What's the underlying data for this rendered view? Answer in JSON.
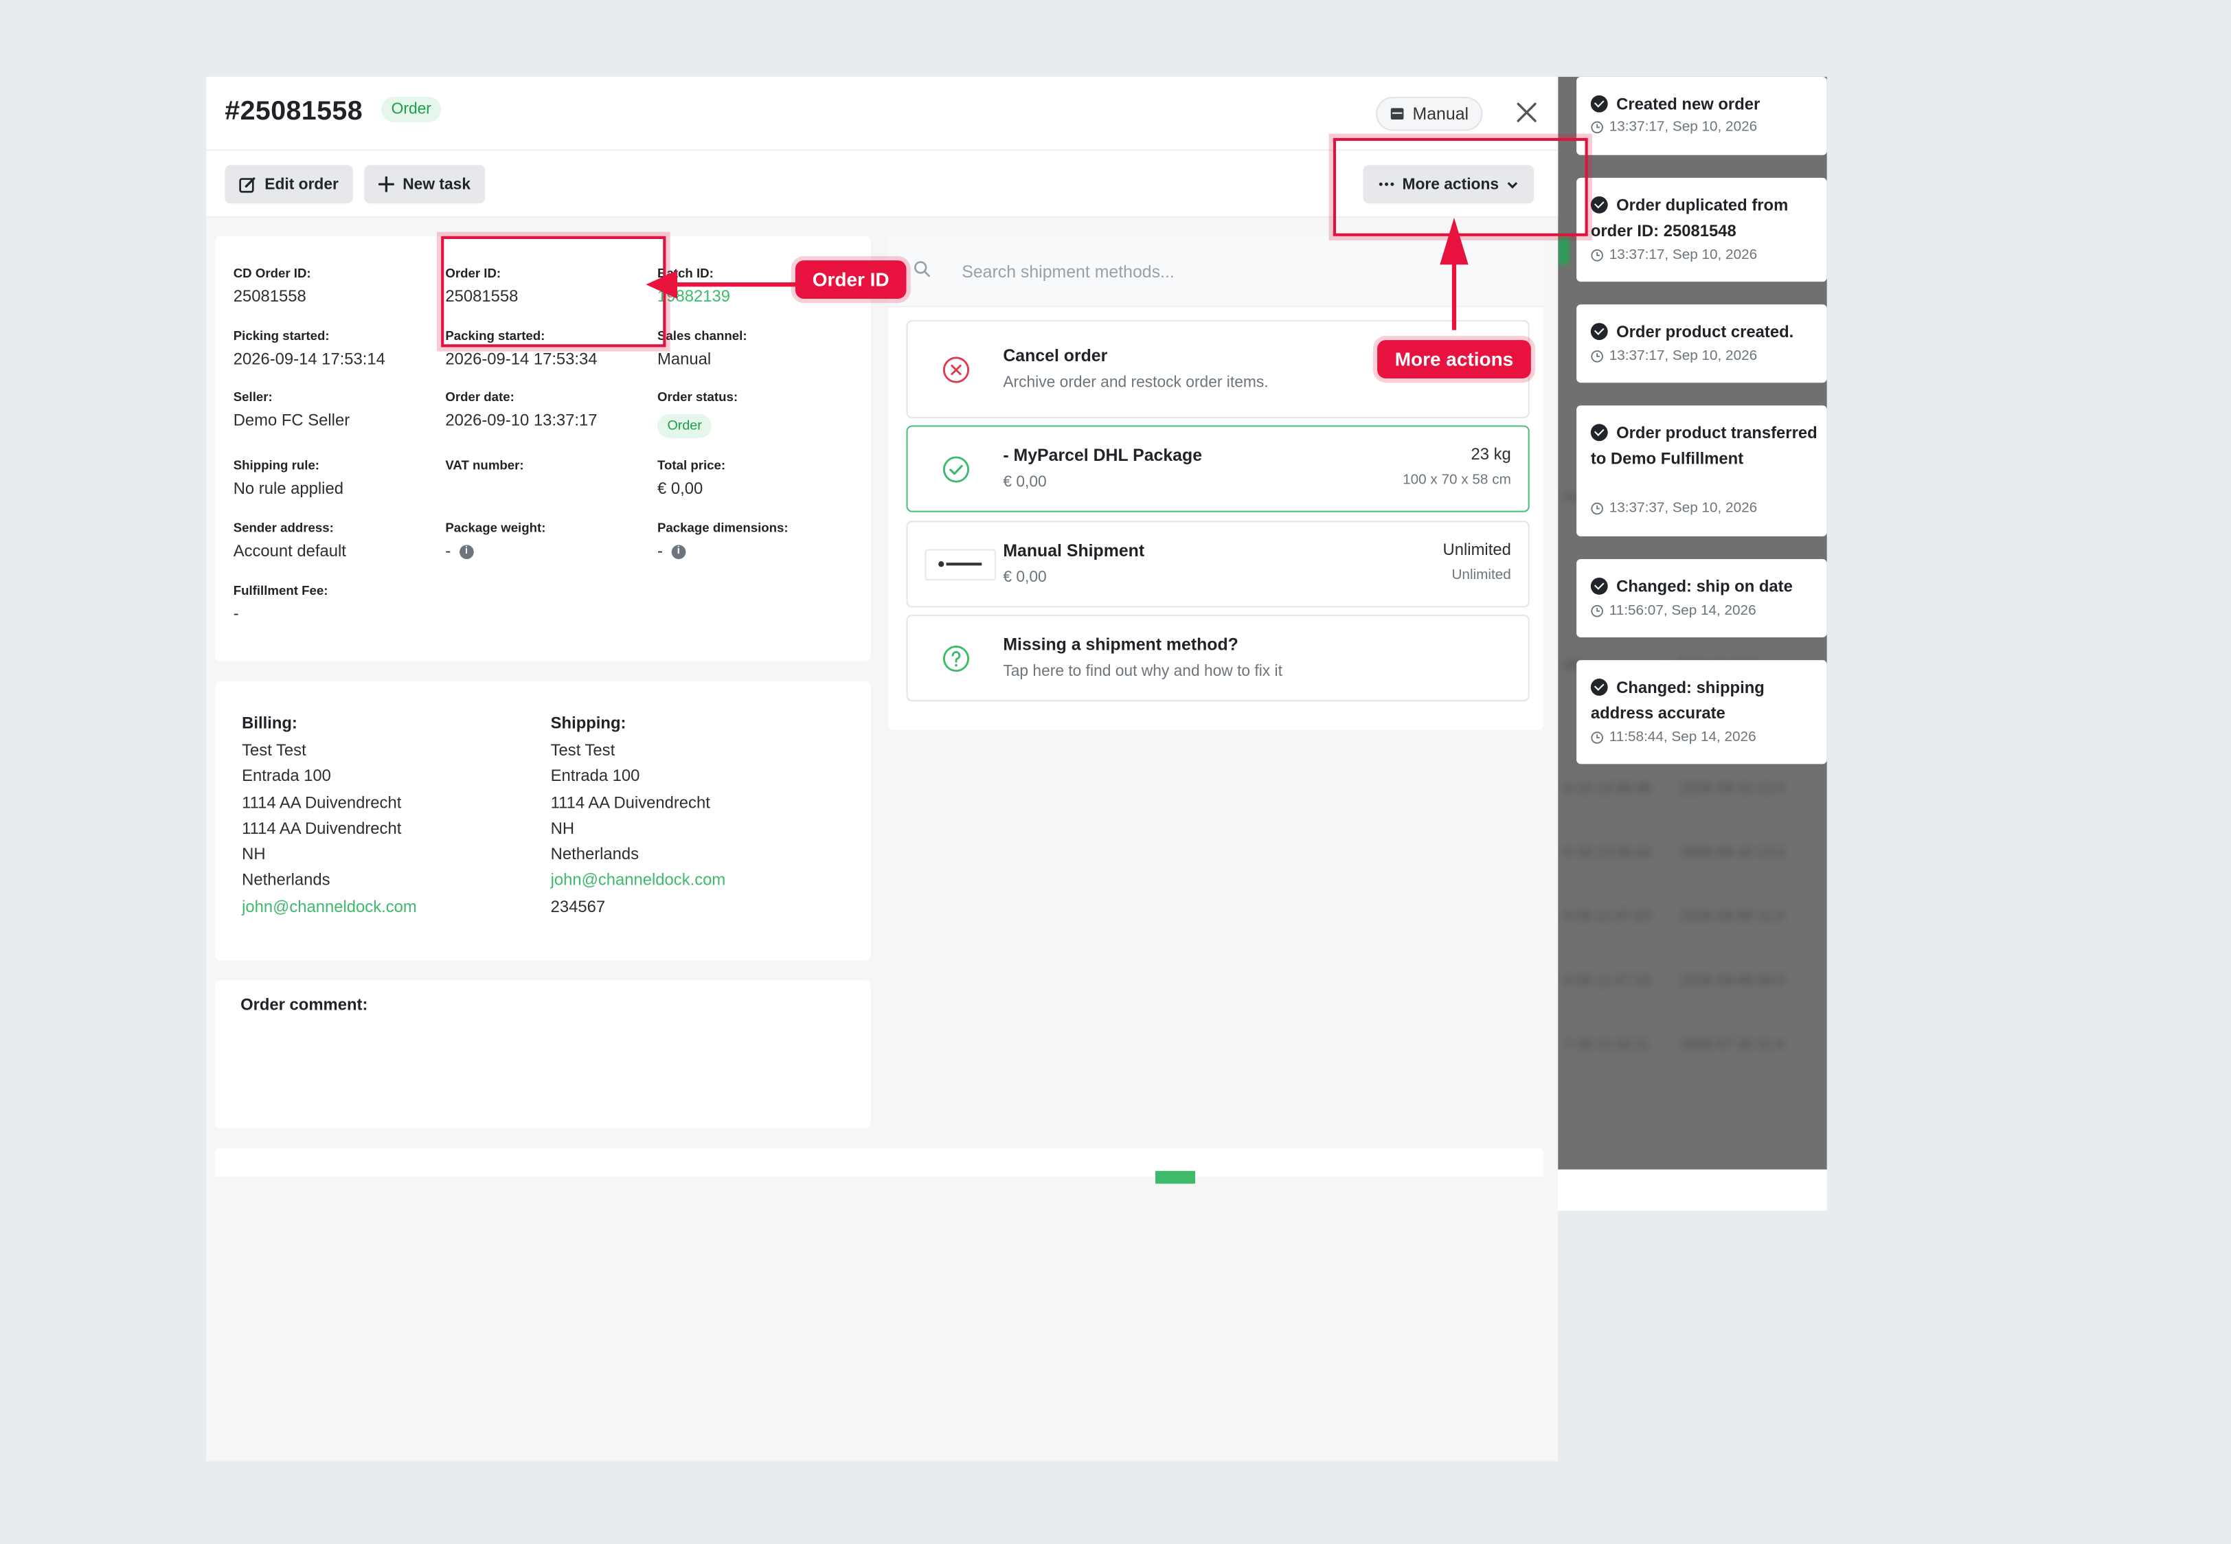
{
  "order": {
    "title": "#25081558",
    "status_badge": "Order",
    "channel_chip": "Manual"
  },
  "toolbar": {
    "edit_label": "Edit order",
    "new_task_label": "New task",
    "more_actions_label": "More actions"
  },
  "info": {
    "cd_order_id": {
      "label": "CD Order ID:",
      "value": "25081558"
    },
    "order_id": {
      "label": "Order ID:",
      "value": "25081558"
    },
    "batch_id": {
      "label": "Batch ID:",
      "value": "19882139"
    },
    "picking_started": {
      "label": "Picking started:",
      "value": "2026-09-14 17:53:14"
    },
    "packing_started": {
      "label": "Packing started:",
      "value": "2026-09-14 17:53:34"
    },
    "sales_channel": {
      "label": "Sales channel:",
      "value": "Manual"
    },
    "seller": {
      "label": "Seller:",
      "value": "Demo FC Seller"
    },
    "order_date": {
      "label": "Order date:",
      "value": "2026-09-10 13:37:17"
    },
    "order_status": {
      "label": "Order status:",
      "value": "Order"
    },
    "shipping_rule": {
      "label": "Shipping rule:",
      "value": "No rule applied"
    },
    "vat_number": {
      "label": "VAT number:",
      "value": ""
    },
    "total_price": {
      "label": "Total price:",
      "value": "€ 0,00"
    },
    "sender_address": {
      "label": "Sender address:",
      "value": "Account default"
    },
    "package_weight": {
      "label": "Package weight:",
      "value": "-"
    },
    "package_dimensions": {
      "label": "Package dimensions:",
      "value": "-"
    },
    "fulfillment_fee": {
      "label": "Fulfillment Fee:",
      "value": "-"
    }
  },
  "billing": {
    "title": "Billing:",
    "lines": [
      "Test Test",
      "Entrada 100",
      "1114 AA Duivendrecht",
      "1114 AA Duivendrecht",
      "NH",
      "Netherlands"
    ],
    "email": "john@channeldock.com"
  },
  "shipping_address": {
    "title": "Shipping:",
    "lines": [
      "Test Test",
      "Entrada 100",
      "1114 AA Duivendrecht",
      "NH",
      "Netherlands"
    ],
    "email": "john@channeldock.com",
    "phone": "234567"
  },
  "comment": {
    "label": "Order comment:"
  },
  "shipment": {
    "search_placeholder": "Search shipment methods...",
    "methods": [
      {
        "title": "Cancel order",
        "subtitle": "Archive order and restock order items.",
        "icon": "x-circle-icon"
      },
      {
        "title": "- MyParcel DHL Package",
        "subtitle": "€ 0,00",
        "weight": "23 kg",
        "dimensions": "100 x 70 x 58 cm",
        "icon": "check-circle-icon",
        "selected": true
      },
      {
        "title": "Manual Shipment",
        "subtitle": "€ 0,00",
        "right_top": "Unlimited",
        "right_bottom": "Unlimited",
        "icon": "channeldock-logo"
      },
      {
        "title": "Missing a shipment method?",
        "subtitle": "Tap here to find out why and how to fix it",
        "icon": "question-circle-icon"
      }
    ]
  },
  "timeline": [
    {
      "title": "Created new order",
      "time": "13:37:17, Sep 10, 2026"
    },
    {
      "title": "Order duplicated from order ID: 25081548",
      "time": "13:37:17, Sep 10, 2026"
    },
    {
      "title": "Order product created.",
      "time": "13:37:17, Sep 10, 2026"
    },
    {
      "title": "Order product transferred to Demo Fulfillment",
      "time": "13:37:37, Sep 10, 2026"
    },
    {
      "title": "Changed: ship on date",
      "time": "11:56:07, Sep 14, 2026"
    },
    {
      "title": "Changed: shipping address accurate",
      "time": "11:58:44, Sep 14, 2026"
    }
  ],
  "annotations": {
    "order_id_callout": "Order ID",
    "more_actions_callout": "More actions"
  },
  "colors": {
    "accent_green": "#3dbb6a",
    "annotation_red": "#e8123e"
  }
}
